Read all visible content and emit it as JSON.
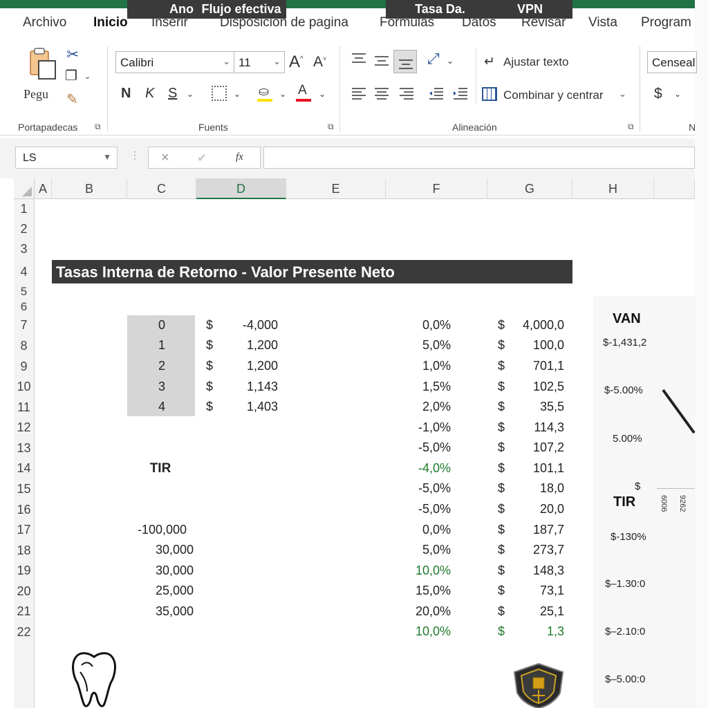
{
  "ribbon_tabs": [
    "Archivo",
    "Inicio",
    "Inserir",
    "Disposición de pagina",
    "Fórmulas",
    "Datos",
    "Revisar",
    "Vista",
    "Program"
  ],
  "clipboard": {
    "paste_label": "Pegu",
    "group_label": "Portapadecas"
  },
  "font": {
    "name": "Calibri",
    "size": "11",
    "group_label": "Fuents",
    "bold": "N",
    "italic": "K",
    "underline": "S",
    "grow": "A",
    "shrink": "A",
    "font_color": "A"
  },
  "alignment": {
    "wrap_label": "Ajustar texto",
    "merge_label": "Combinar y centrar",
    "group_label": "Alineación"
  },
  "number": {
    "format_value": "Censeal",
    "currency": "$",
    "group_label": "N"
  },
  "formula_bar": {
    "name_box": "LS",
    "cancel": "×",
    "enter": "✔",
    "fx": "fx",
    "value": ""
  },
  "columns": [
    "A",
    "B",
    "C",
    "D",
    "E",
    "F",
    "G",
    "H"
  ],
  "rows": [
    "1",
    "2",
    "3",
    "4",
    "5",
    "6",
    "7",
    "8",
    "9",
    "10",
    "11",
    "12",
    "13",
    "14",
    "15",
    "16",
    "17",
    "18",
    "19",
    "20",
    "21",
    "22"
  ],
  "title": "Tasas Interna de Retorno - Valor Presente  Neto",
  "cashflow_table": {
    "headers": [
      "Ano",
      "Flujo efectiva"
    ],
    "rows": [
      {
        "year": "0",
        "cur": "$",
        "flow": "-4,000"
      },
      {
        "year": "1",
        "cur": "$",
        "flow": "1,200"
      },
      {
        "year": "2",
        "cur": "$",
        "flow": "1,200"
      },
      {
        "year": "3",
        "cur": "$",
        "flow": "1,143"
      },
      {
        "year": "4",
        "cur": "$",
        "flow": "1,403"
      }
    ]
  },
  "tir_label": "TIR",
  "flows_list": [
    "-100,000",
    "30,000",
    "30,000",
    "25,000",
    "35,000"
  ],
  "rate_table": {
    "headers": [
      "Tasa Da.",
      "VPN"
    ],
    "rows": [
      {
        "rate": "0,0%",
        "cur": "$",
        "vpn": "4,000,0",
        "green": false
      },
      {
        "rate": "5,0%",
        "cur": "$",
        "vpn": "100,0",
        "green": false
      },
      {
        "rate": "1,0%",
        "cur": "$",
        "vpn": "701,1",
        "green": false
      },
      {
        "rate": "1,5%",
        "cur": "$",
        "vpn": "102,5",
        "green": false
      },
      {
        "rate": "2,0%",
        "cur": "$",
        "vpn": "35,5",
        "green": false
      },
      {
        "rate": "-1,0%",
        "cur": "$",
        "vpn": "114,3",
        "green": false
      },
      {
        "rate": "-5,0%",
        "cur": "$",
        "vpn": "107,2",
        "green": false
      },
      {
        "rate": "-4,0%",
        "cur": "$",
        "vpn": "101,1",
        "green": true
      },
      {
        "rate": "-5,0%",
        "cur": "$",
        "vpn": "18,0",
        "green": false
      },
      {
        "rate": "-5,0%",
        "cur": "$",
        "vpn": "20,0",
        "green": false
      },
      {
        "rate": "0,0%",
        "cur": "$",
        "vpn": "187,7",
        "green": false
      },
      {
        "rate": "5,0%",
        "cur": "$",
        "vpn": "273,7",
        "green": false
      },
      {
        "rate": "10,0%",
        "cur": "$",
        "vpn": "148,3",
        "green": true
      },
      {
        "rate": "15,0%",
        "cur": "$",
        "vpn": "73,1",
        "green": false
      },
      {
        "rate": "20,0%",
        "cur": "$",
        "vpn": "25,1",
        "green": false
      },
      {
        "rate": "10,0%",
        "cur": "$",
        "vpn": "1,3",
        "green": true,
        "all_green": true
      }
    ]
  },
  "van_panel": {
    "title": "VAN",
    "labels": [
      "$-1,431,2",
      "$-5.00%",
      "5.00%",
      "$"
    ],
    "rotated_ticks": [
      "6006",
      "9262"
    ]
  },
  "tir_panel": {
    "title": "TIR",
    "labels": [
      "$-130%",
      "$–1.30:0",
      "$–2.10:0",
      "$–5.00:0"
    ]
  },
  "colors": {
    "accent": "#217346",
    "header_dark": "#3a3a3a",
    "green_text": "#1f7a2b",
    "year_fill": "#d6d6d6"
  }
}
